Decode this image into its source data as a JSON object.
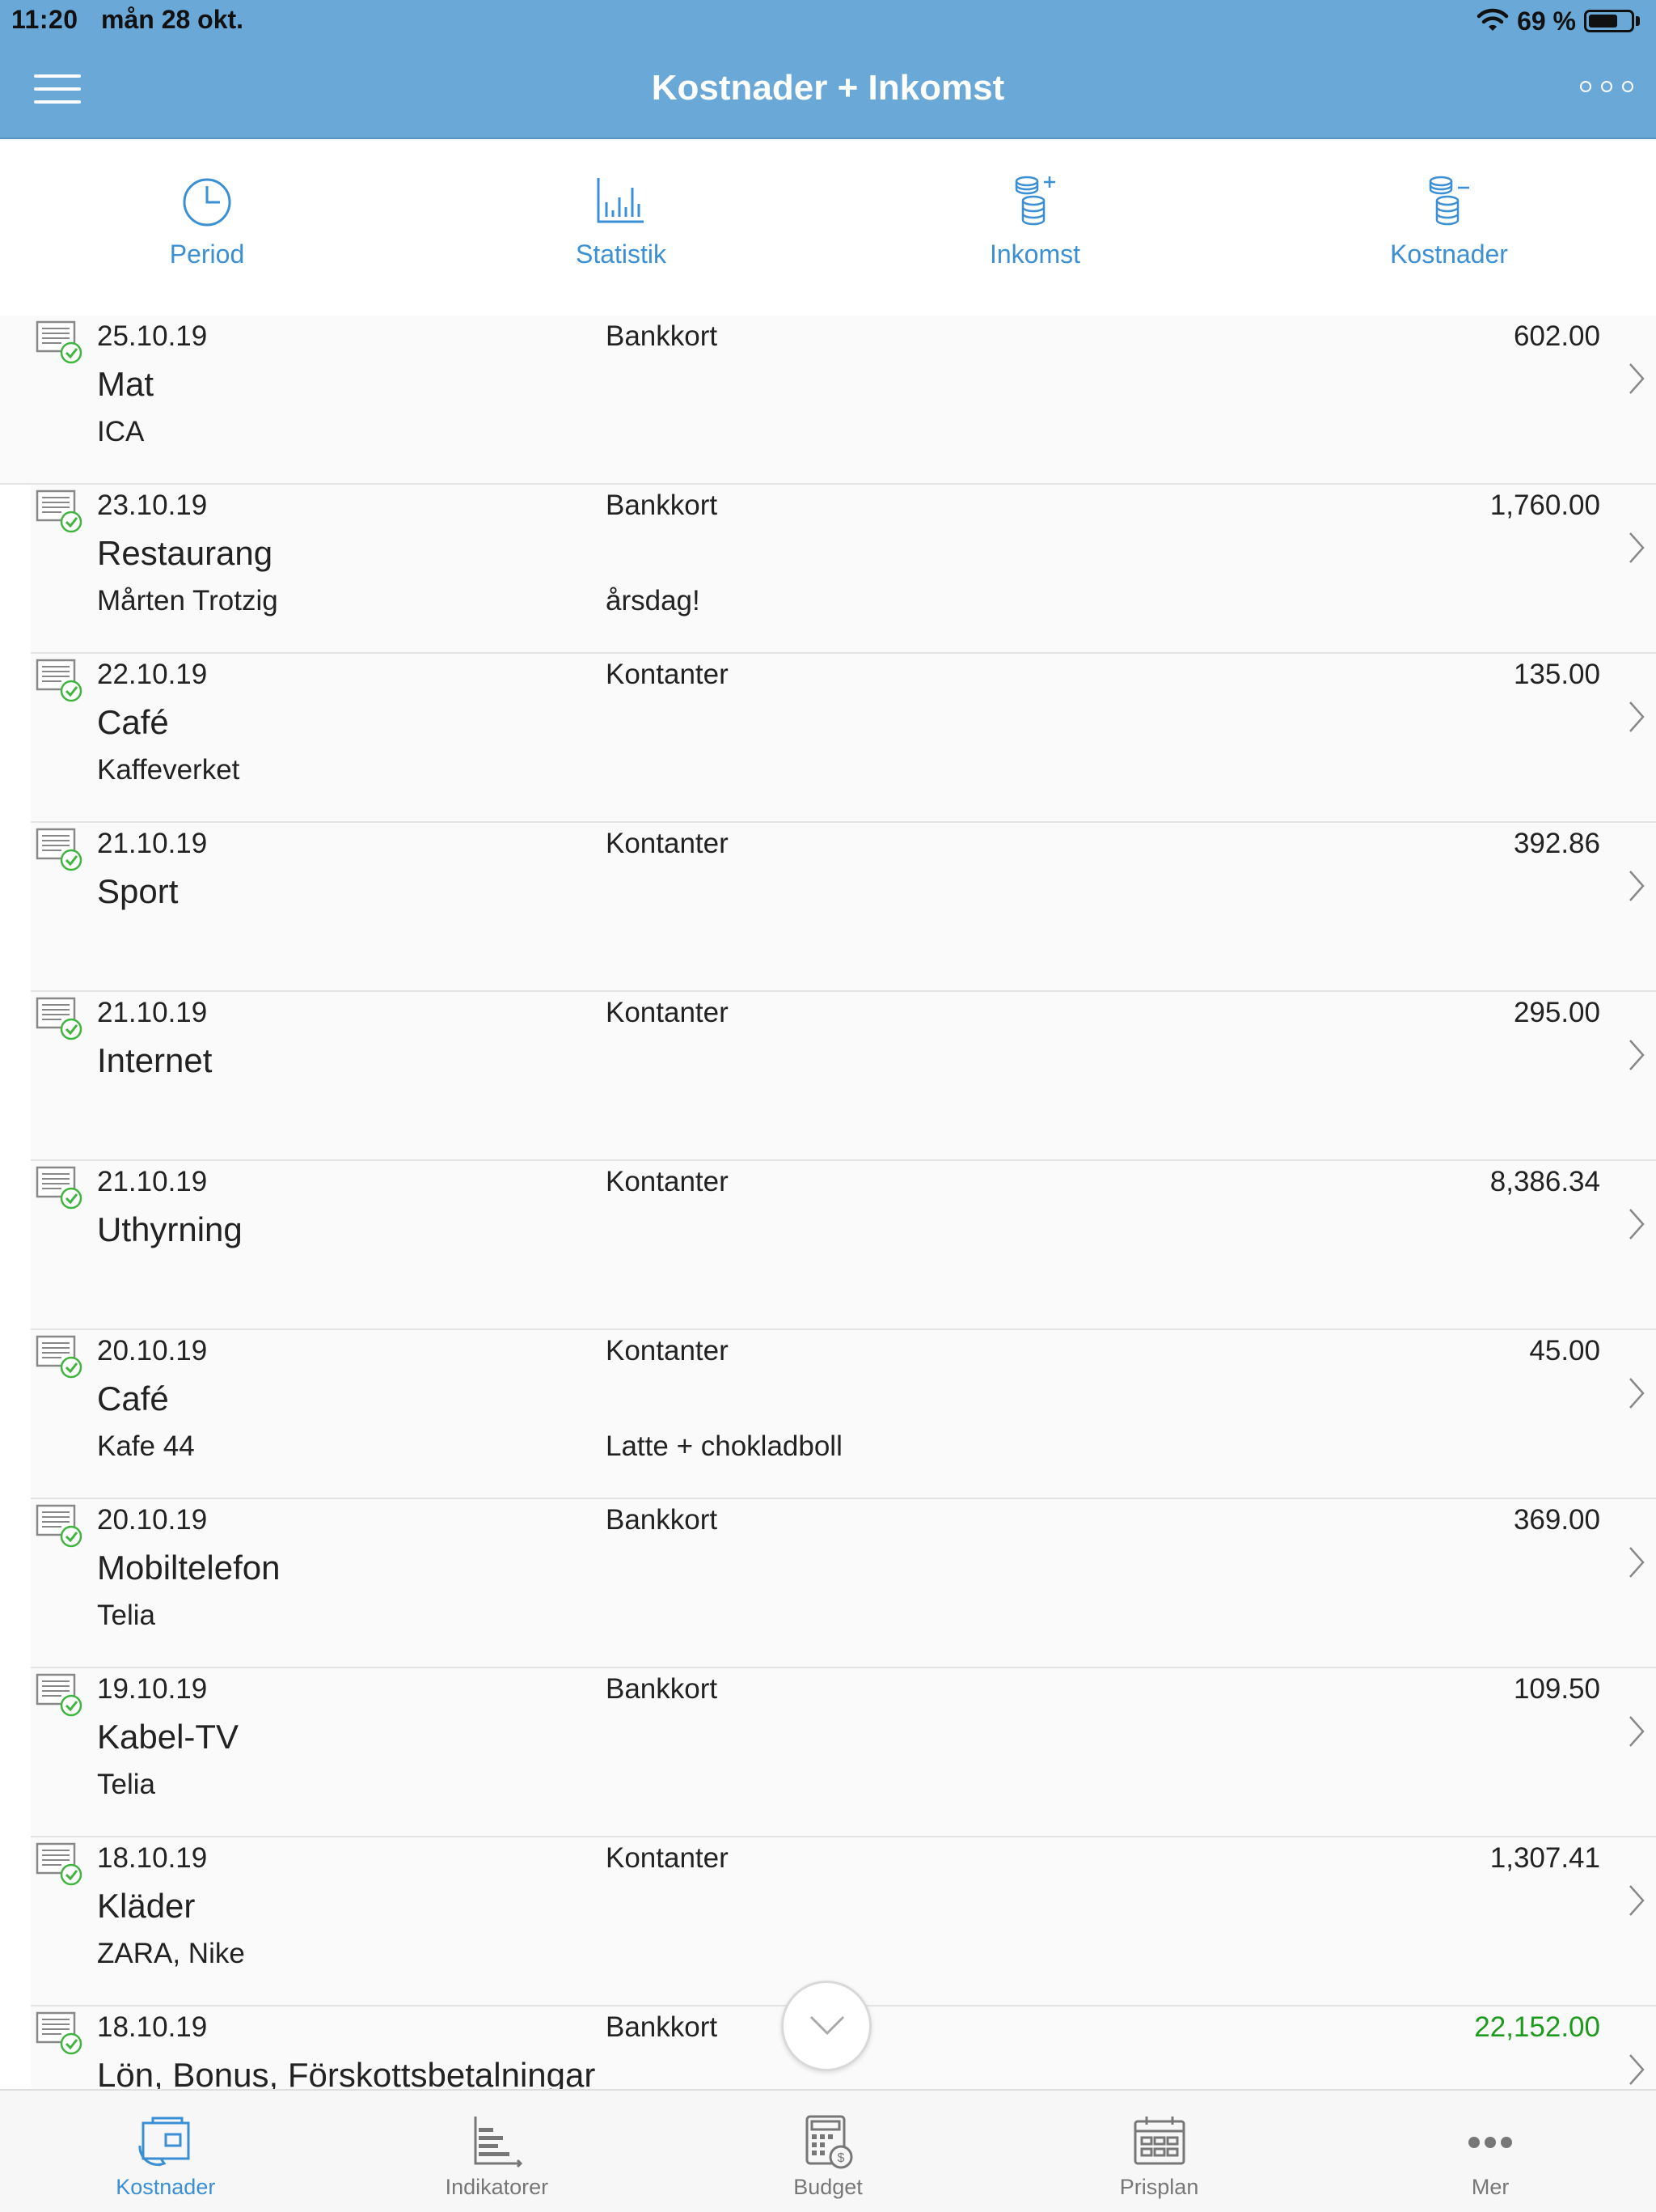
{
  "status": {
    "time": "11:20",
    "date": "mån 28 okt.",
    "battery": "69 %",
    "battery_level": 0.69
  },
  "header": {
    "title": "Kostnader + Inkomst"
  },
  "toolbar": [
    {
      "label": "Period",
      "icon": "clock-icon"
    },
    {
      "label": "Statistik",
      "icon": "bar-chart-icon"
    },
    {
      "label": "Inkomst",
      "icon": "coins-plus-icon"
    },
    {
      "label": "Kostnader",
      "icon": "coins-minus-icon"
    }
  ],
  "transactions": [
    {
      "date": "25.10.19",
      "category": "Mat",
      "sub": "ICA",
      "payment": "Bankkort",
      "note": "",
      "amount": "602.00",
      "type": "expense"
    },
    {
      "date": "23.10.19",
      "category": "Restaurang",
      "sub": "Mårten Trotzig",
      "payment": "Bankkort",
      "note": "årsdag!",
      "amount": "1,760.00",
      "type": "expense"
    },
    {
      "date": "22.10.19",
      "category": "Café",
      "sub": "Kaffeverket",
      "payment": "Kontanter",
      "note": "",
      "amount": "135.00",
      "type": "expense"
    },
    {
      "date": "21.10.19",
      "category": "Sport",
      "sub": "",
      "payment": "Kontanter",
      "note": "",
      "amount": "392.86",
      "type": "expense"
    },
    {
      "date": "21.10.19",
      "category": "Internet",
      "sub": "",
      "payment": "Kontanter",
      "note": "",
      "amount": "295.00",
      "type": "expense"
    },
    {
      "date": "21.10.19",
      "category": "Uthyrning",
      "sub": "",
      "payment": "Kontanter",
      "note": "",
      "amount": "8,386.34",
      "type": "expense"
    },
    {
      "date": "20.10.19",
      "category": "Café",
      "sub": "Kafe 44",
      "payment": "Kontanter",
      "note": "Latte + chokladboll",
      "amount": "45.00",
      "type": "expense"
    },
    {
      "date": "20.10.19",
      "category": "Mobiltelefon",
      "sub": "Telia",
      "payment": "Bankkort",
      "note": "",
      "amount": "369.00",
      "type": "expense"
    },
    {
      "date": "19.10.19",
      "category": "Kabel-TV",
      "sub": "Telia",
      "payment": "Bankkort",
      "note": "",
      "amount": "109.50",
      "type": "expense"
    },
    {
      "date": "18.10.19",
      "category": "Kläder",
      "sub": "ZARA, Nike",
      "payment": "Kontanter",
      "note": "",
      "amount": "1,307.41",
      "type": "expense"
    },
    {
      "date": "18.10.19",
      "category": "Lön, Bonus, Förskottsbetalningar",
      "sub": "",
      "payment": "Bankkort",
      "note": "",
      "amount": "22,152.00",
      "type": "income"
    }
  ],
  "tabs": [
    {
      "label": "Kostnader",
      "icon": "wallet-transfer-icon",
      "active": true
    },
    {
      "label": "Indikatorer",
      "icon": "indicators-chart-icon",
      "active": false
    },
    {
      "label": "Budget",
      "icon": "budget-calculator-icon",
      "active": false
    },
    {
      "label": "Prisplan",
      "icon": "calendar-icon",
      "active": false
    },
    {
      "label": "Mer",
      "icon": "more-dots-icon",
      "active": false
    }
  ],
  "colors": {
    "header": "#6aa8d8",
    "accent": "#3b8fd4",
    "income": "#1e9a1e",
    "check": "#3fb53f"
  }
}
